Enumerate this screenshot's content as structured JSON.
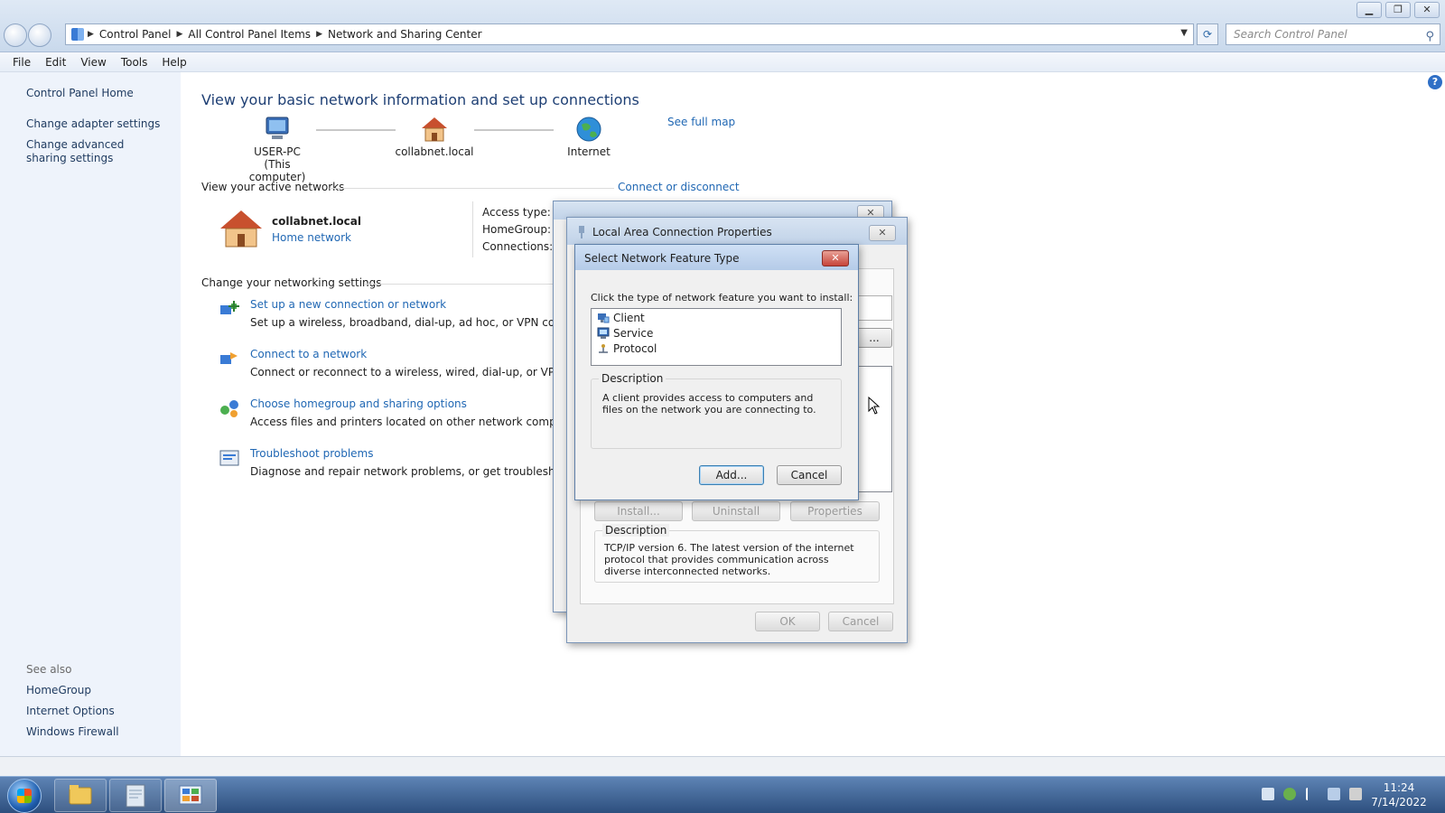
{
  "window": {
    "breadcrumb": [
      "Control Panel",
      "All Control Panel Items",
      "Network and Sharing Center"
    ],
    "search_placeholder": "Search Control Panel"
  },
  "menu": [
    "File",
    "Edit",
    "View",
    "Tools",
    "Help"
  ],
  "left_pane": {
    "home": "Control Panel Home",
    "links": [
      "Change adapter settings",
      "Change advanced sharing settings"
    ],
    "see_also_label": "See also",
    "see_also": [
      "HomeGroup",
      "Internet Options",
      "Windows Firewall"
    ]
  },
  "main": {
    "title": "View your basic network information and set up connections",
    "see_full_map": "See full map",
    "map": {
      "computer_name": "USER-PC",
      "computer_sub": "(This computer)",
      "network": "collabnet.local",
      "internet": "Internet"
    },
    "active_networks_label": "View your active networks",
    "connect_disconnect": "Connect or disconnect",
    "active_network": {
      "name": "collabnet.local",
      "type": "Home network",
      "access_type_label": "Access type:",
      "homegroup_label": "HomeGroup:",
      "connections_label": "Connections:"
    },
    "change_settings_label": "Change your networking settings",
    "tasks": [
      {
        "title": "Set up a new connection or network",
        "desc": "Set up a wireless, broadband, dial-up, ad hoc, or VPN connection"
      },
      {
        "title": "Connect to a network",
        "desc": "Connect or reconnect to a wireless, wired, dial-up, or VPN netw"
      },
      {
        "title": "Choose homegroup and sharing options",
        "desc": "Access files and printers located on other network computers, o"
      },
      {
        "title": "Troubleshoot problems",
        "desc": "Diagnose and repair network problems, or get troubleshooting i"
      }
    ]
  },
  "lac_dialog": {
    "title": "Local Area Connection Properties",
    "install": "Install...",
    "uninstall": "Uninstall",
    "properties": "Properties",
    "description_label": "Description",
    "description": "TCP/IP version 6. The latest version of the internet protocol that provides communication across diverse interconnected networks.",
    "ok": "OK",
    "cancel": "Cancel",
    "small_btn": "..."
  },
  "feature_dialog": {
    "title": "Select Network Feature Type",
    "prompt": "Click the type of network feature you want to install:",
    "items": [
      "Client",
      "Service",
      "Protocol"
    ],
    "description_label": "Description",
    "description": "A client provides access to computers and files on the network you are connecting to.",
    "add": "Add...",
    "cancel": "Cancel"
  },
  "taskbar": {
    "time": "11:24",
    "date": "7/14/2022"
  }
}
